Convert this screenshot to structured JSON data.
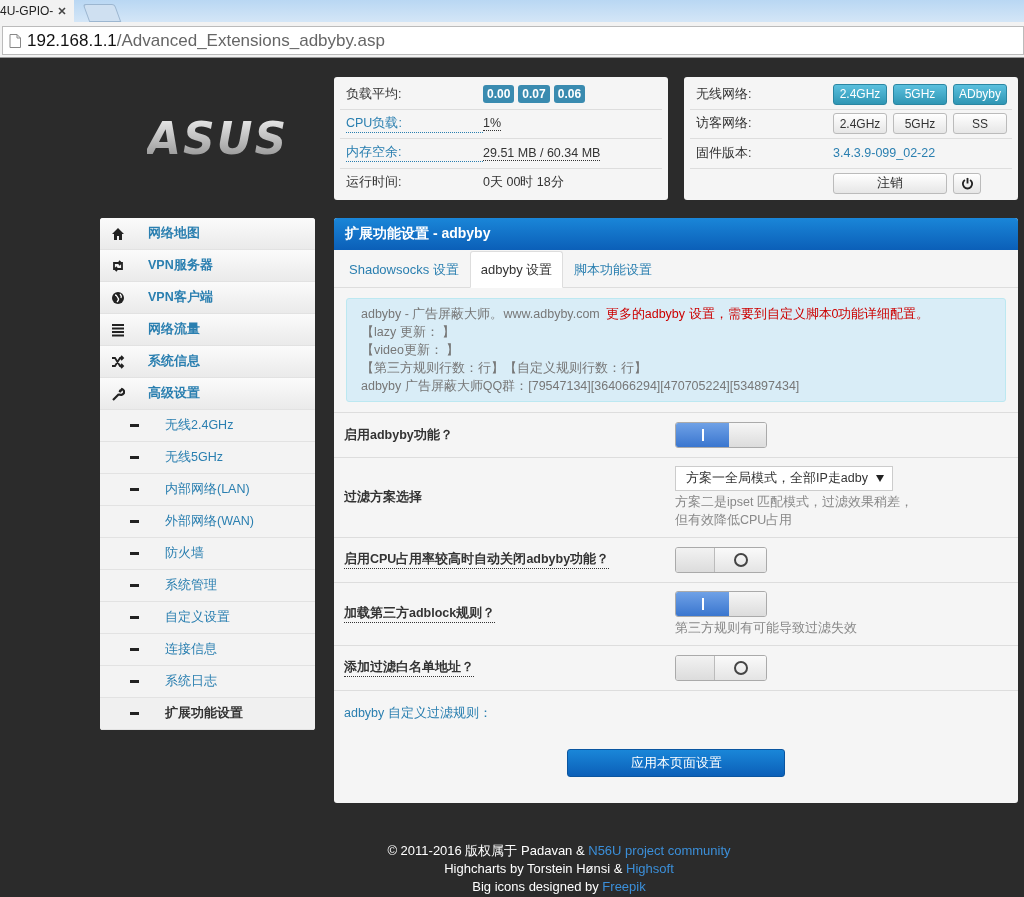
{
  "browser": {
    "tab_title": "4U-GPIO-",
    "url_host": "192.168.1.1",
    "url_path": "/Advanced_Extensions_adbyby.asp"
  },
  "logo": "ASUS",
  "status_left": [
    {
      "label": "负载平均:",
      "label_link": false,
      "kind": "badges",
      "badges": [
        "0.00",
        "0.07",
        "0.06"
      ]
    },
    {
      "label": "CPU负载:",
      "label_link": true,
      "kind": "text",
      "value": "1%",
      "value_dotted": true
    },
    {
      "label": "内存空余:",
      "label_link": true,
      "kind": "text",
      "value": "29.51 MB / 60.34 MB",
      "value_dotted": true
    },
    {
      "label": "运行时间:",
      "label_link": false,
      "kind": "text",
      "value": "0天 00时 18分",
      "value_dotted": false
    }
  ],
  "status_right": [
    {
      "label": "无线网络:",
      "kind": "buttons",
      "buttons": [
        {
          "label": "2.4GHz",
          "active": true
        },
        {
          "label": "5GHz",
          "active": true
        },
        {
          "label": "ADbyby",
          "active": true
        }
      ]
    },
    {
      "label": "访客网络:",
      "kind": "buttons",
      "buttons": [
        {
          "label": "2.4GHz",
          "active": false
        },
        {
          "label": "5GHz",
          "active": false
        },
        {
          "label": "SS",
          "active": false
        }
      ]
    },
    {
      "label": "固件版本:",
      "kind": "link",
      "value": "3.4.3.9-099_02-22"
    }
  ],
  "logout": "注销",
  "sidebar": [
    {
      "label": "网络地图",
      "kind": "home",
      "selected": false
    },
    {
      "label": "VPN服务器",
      "kind": "retweet",
      "selected": false
    },
    {
      "label": "VPN客户端",
      "kind": "globe",
      "selected": false
    },
    {
      "label": "网络流量",
      "kind": "list",
      "selected": false
    },
    {
      "label": "系统信息",
      "kind": "shuffle",
      "selected": false
    },
    {
      "label": "高级设置",
      "kind": "wrench",
      "selected": false,
      "children": [
        {
          "label": "无线2.4GHz",
          "selected": false
        },
        {
          "label": "无线5GHz",
          "selected": false
        },
        {
          "label": "内部网络(LAN)",
          "selected": false
        },
        {
          "label": "外部网络(WAN)",
          "selected": false
        },
        {
          "label": "防火墙",
          "selected": false
        },
        {
          "label": "系统管理",
          "selected": false
        },
        {
          "label": "自定义设置",
          "selected": false
        },
        {
          "label": "连接信息",
          "selected": false
        },
        {
          "label": "系统日志",
          "selected": false
        },
        {
          "label": "扩展功能设置",
          "selected": true
        }
      ]
    }
  ],
  "main": {
    "title": "扩展功能设置 - adbyby",
    "tabs": [
      {
        "label": "Shadowsocks 设置",
        "selected": false
      },
      {
        "label": "adbyby 设置",
        "selected": true
      },
      {
        "label": "脚本功能设置",
        "selected": false
      }
    ],
    "info": [
      [
        {
          "text": "adbyby - 广告屏蔽大师。www.adbyby.com",
          "kind": "muted"
        },
        {
          "text": "更多的adbyby 设置，需要到自定义脚本0功能详细配置。",
          "kind": "alert"
        }
      ],
      [
        {
          "text": "【lazy 更新： 】",
          "kind": "muted"
        }
      ],
      [
        {
          "text": "【video更新： 】",
          "kind": "muted"
        }
      ],
      [
        {
          "text": "【第三方规则行数：行】【自定义规则行数：行】",
          "kind": "muted"
        }
      ],
      [
        {
          "text": "adbyby 广告屏蔽大师QQ群：[79547134][364066294][470705224][534897434]",
          "kind": "muted"
        }
      ]
    ],
    "settings": [
      {
        "label": "启用adbyby功能？",
        "dotted": false,
        "kind": "switch",
        "on": true
      },
      {
        "label": "过滤方案选择",
        "dotted": false,
        "kind": "select",
        "value": "方案一全局模式，全部IP走adby",
        "hint": "方案二是ipset 匹配模式，过滤效果稍差，但有效降低CPU占用"
      },
      {
        "label": "启用CPU占用率较高时自动关闭adbyby功能？",
        "dotted": true,
        "kind": "switch",
        "on": false
      },
      {
        "label": "加载第三方adblock规则？",
        "dotted": true,
        "kind": "switch",
        "on": true,
        "hint": "第三方规则有可能导致过滤失效"
      },
      {
        "label": "添加过滤白名单地址？",
        "dotted": true,
        "kind": "switch",
        "on": false
      }
    ],
    "rules_link": "adbyby 自定义过滤规则：",
    "apply": "应用本页面设置"
  },
  "footer": [
    [
      {
        "text": "© 2011-2016 版权属于 Padavan & ",
        "kind": "text"
      },
      {
        "text": "N56U project community",
        "kind": "link"
      }
    ],
    [
      {
        "text": "Highcharts by Torstein Hønsi & ",
        "kind": "text"
      },
      {
        "text": "Highsoft",
        "kind": "link"
      }
    ],
    [
      {
        "text": "Big icons designed by ",
        "kind": "text"
      },
      {
        "text": "Freepik",
        "kind": "link"
      }
    ]
  ]
}
